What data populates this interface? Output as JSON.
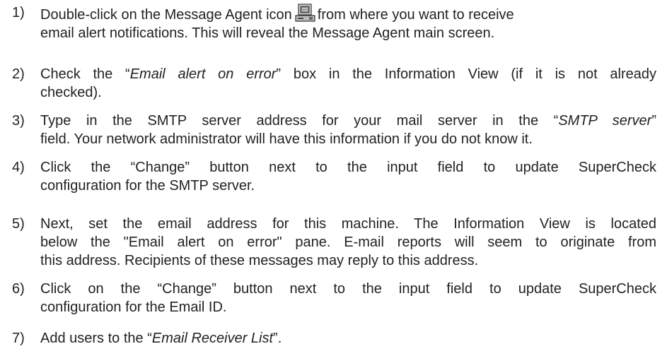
{
  "steps": [
    {
      "number": "1)",
      "line1_before_icon": "Double-click on the Message Agent icon",
      "line1_after_icon": "from where you want to receive",
      "line2": "email alert notifications. This will reveal the Message Agent main screen.",
      "icon": "message-agent-computer-icon"
    },
    {
      "number": "2)",
      "line1_pre": "Check the “",
      "line1_em": "Email alert on error",
      "line1_post": "” box in the Information View (if it is not already",
      "line2": "checked)."
    },
    {
      "number": "3)",
      "line1_pre": "Type in the SMTP server address for your mail server in the “",
      "line1_em": "SMTP server",
      "line1_post": "”",
      "line2": "field. Your network administrator will have this information if you do not know it."
    },
    {
      "number": "4)",
      "line1": "Click the “Change” button next to the input field to update SuperCheck",
      "line2": "configuration for the SMTP server."
    },
    {
      "number": "5)",
      "line1": "Next, set the email address for this machine. The Information View is located",
      "line2": "below the \"Email alert on error\" pane. E-mail reports will seem to originate from",
      "line3": "this address. Recipients of these messages may reply to this address."
    },
    {
      "number": "6)",
      "line1": "Click on the “Change” button next to the input field to update SuperCheck",
      "line2": "configuration for the Email ID."
    },
    {
      "number": "7)",
      "line1_pre": "Add users to the “",
      "line1_em": "Email Receiver List",
      "line1_post": "”."
    }
  ]
}
